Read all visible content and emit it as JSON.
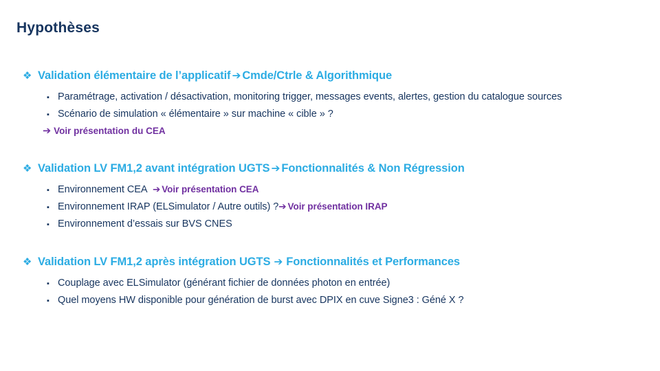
{
  "slide": {
    "title": "Hypothèses",
    "colors": {
      "title": "#17355F",
      "heading": "#2CACE3",
      "body": "#17355F",
      "emphasis": "#7030A0",
      "background": "#FFFFFF"
    },
    "icons": {
      "diamond_bullet": "❖",
      "square_bullet": "▪",
      "arrow": "➔"
    },
    "sections": [
      {
        "heading_prefix": "Validation élémentaire de l’applicatif",
        "heading_suffix": "Cmde/Ctrle & Algorithmique",
        "items": [
          {
            "text": "Paramétrage, activation / désactivation, monitoring trigger, messages events, alertes, gestion du catalogue sources"
          },
          {
            "text": "Scénario de simulation « élémentaire » sur machine « cible » ?"
          }
        ],
        "arrow_line": "Voir présentation du CEA"
      },
      {
        "heading_prefix": "Validation LV FM1,2 avant intégration UGTS",
        "heading_suffix": "Fonctionnalités & Non Régression",
        "items": [
          {
            "text": "Environnement CEA",
            "emphasis": "Voir présentation CEA"
          },
          {
            "text": "Environnement IRAP (ELSimulator / Autre outils) ?",
            "emphasis": "Voir présentation IRAP"
          },
          {
            "text": "Environnement d’essais sur BVS CNES"
          }
        ]
      },
      {
        "heading_prefix": "Validation LV FM1,2 après intégration UGTS",
        "heading_suffix": "Fonctionnalités et Performances",
        "items": [
          {
            "text": "Couplage avec ELSimulator (générant fichier de données photon en entrée)"
          },
          {
            "text": "Quel moyens HW disponible pour génération de burst avec DPIX en cuve Signe3 : Géné X ?"
          }
        ]
      }
    ]
  }
}
